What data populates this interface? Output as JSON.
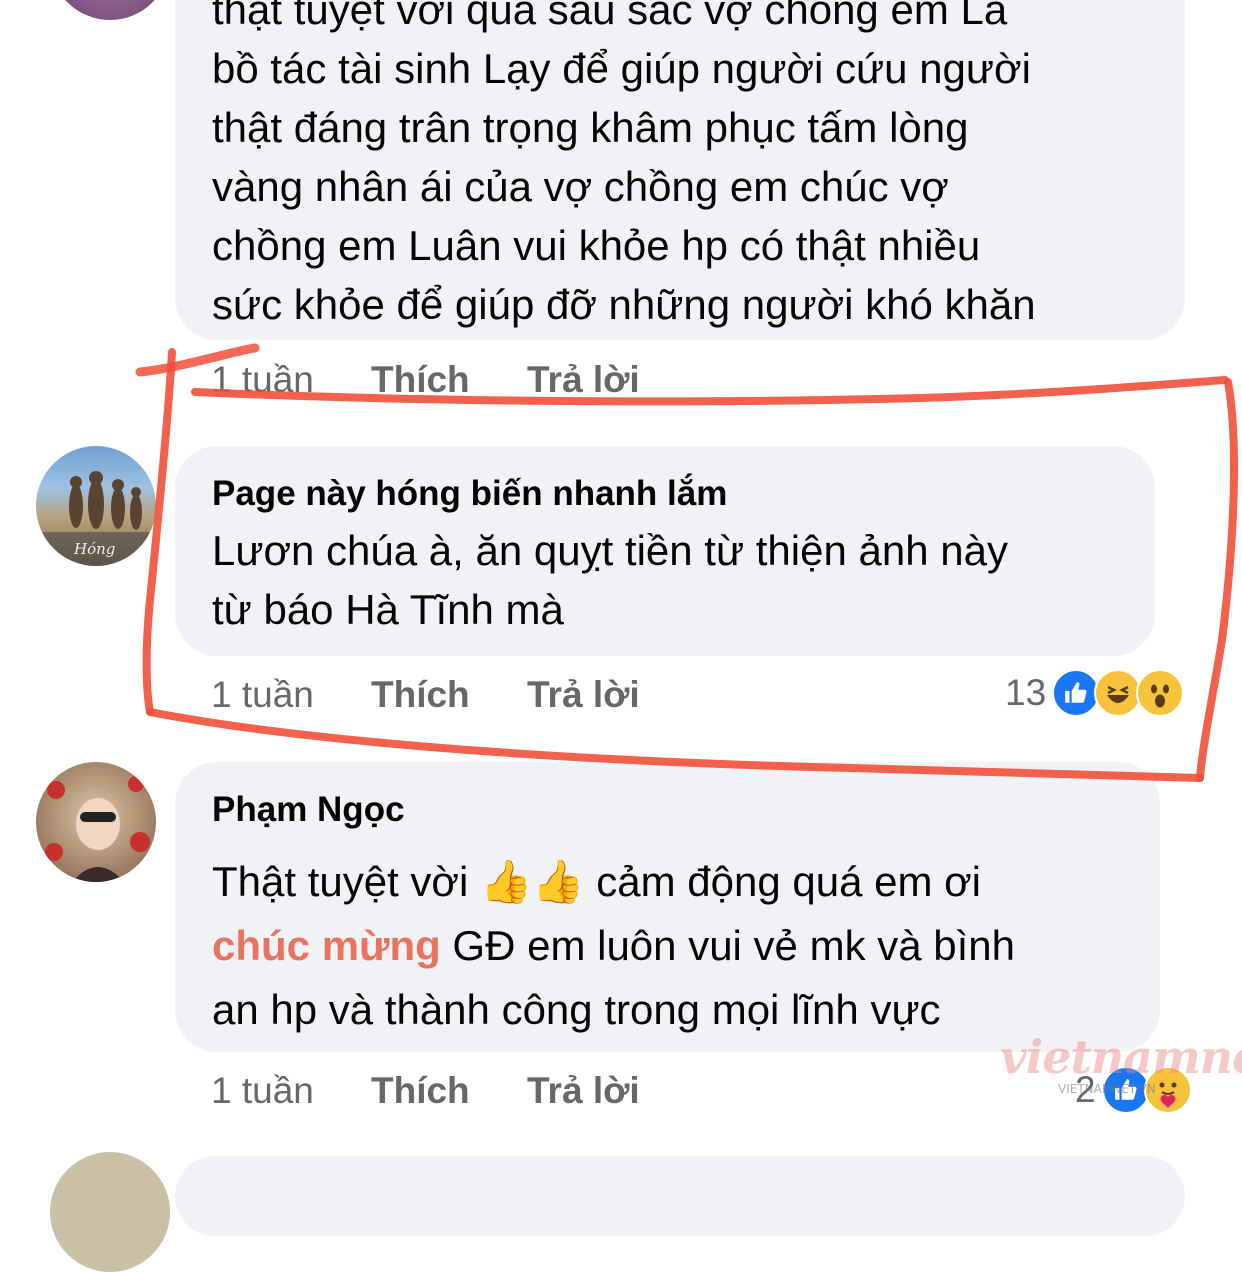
{
  "comments": [
    {
      "text": "thật tuyệt vời quá sâu sắc vợ chồng em Là\nbồ tác tài sinh Lạy để giúp người cứu người\nthật đáng trân trọng khâm phục tấm lòng\nvàng nhân ái của vợ chồng em chúc vợ\nchồng em Luân vui khỏe hp có thật nhiều\nsức khỏe để giúp đỡ những người khó khăn",
      "time": "1 tuần",
      "like_label": "Thích",
      "reply_label": "Trả lời"
    },
    {
      "author": "Page này hóng biến nhanh lắm",
      "avatar_caption": "Hóng",
      "text": "Lươn chúa à, ăn quỵt tiền từ thiện ảnh này\ntừ báo Hà Tĩnh mà",
      "time": "1 tuần",
      "like_label": "Thích",
      "reply_label": "Trả lời",
      "reaction_count": "13",
      "reactions": [
        "like-icon",
        "haha-icon",
        "wow-icon"
      ]
    },
    {
      "author": "Phạm Ngọc",
      "text_line1_a": "Thật tuyệt vời ",
      "emoji": "👍👍",
      "text_line1_b": " cảm động quá em ơi",
      "text_highlight": "chúc mừng",
      "text_line2": " GĐ em luôn vui vẻ mk và bình",
      "text_line3": "an hp và thành công trong mọi lĩnh vực",
      "time": "1 tuần",
      "like_label": "Thích",
      "reply_label": "Trả lời",
      "reaction_count": "2",
      "reactions": [
        "like-icon",
        "care-icon"
      ]
    }
  ],
  "watermark": {
    "brand": "vietnamnet",
    "sub": "VIETNAMNET.VN"
  },
  "colors": {
    "bubble": "#f0f2f5",
    "meta_text": "#65676b",
    "annotation_red": "#f0503a",
    "highlight": "#e8745f",
    "like_blue": "#1877f2",
    "emoji_yellow": "#f7c33d"
  }
}
